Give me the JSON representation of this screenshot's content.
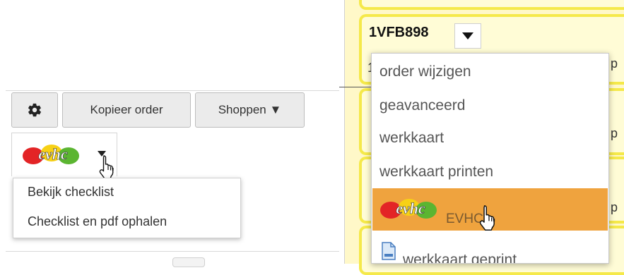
{
  "toolbar": {
    "copy_order_label": "Kopieer order",
    "shop_label": "Shoppen ▼"
  },
  "evhc_dropdown": {
    "logo_text": "evhc",
    "items": [
      {
        "label": "Bekijk checklist"
      },
      {
        "label": "Checklist en pdf ophalen"
      }
    ]
  },
  "order": {
    "number": "1VFB898",
    "menu": [
      {
        "label": "order wijzigen"
      },
      {
        "label": "geavanceerd"
      },
      {
        "label": "werkkaart"
      },
      {
        "label": "werkkaart printen"
      },
      {
        "label": "EVHC"
      },
      {
        "label": "werkkaart geprint"
      }
    ]
  },
  "card_fragments": [
    "1",
    "p",
    "p",
    "p"
  ],
  "colors": {
    "card_border": "#f5e94a",
    "card_bg": "#fffcd6",
    "highlight": "#efa33e",
    "logo_red": "#e32426",
    "logo_yellow": "#f7d116",
    "logo_green": "#5bb531"
  }
}
